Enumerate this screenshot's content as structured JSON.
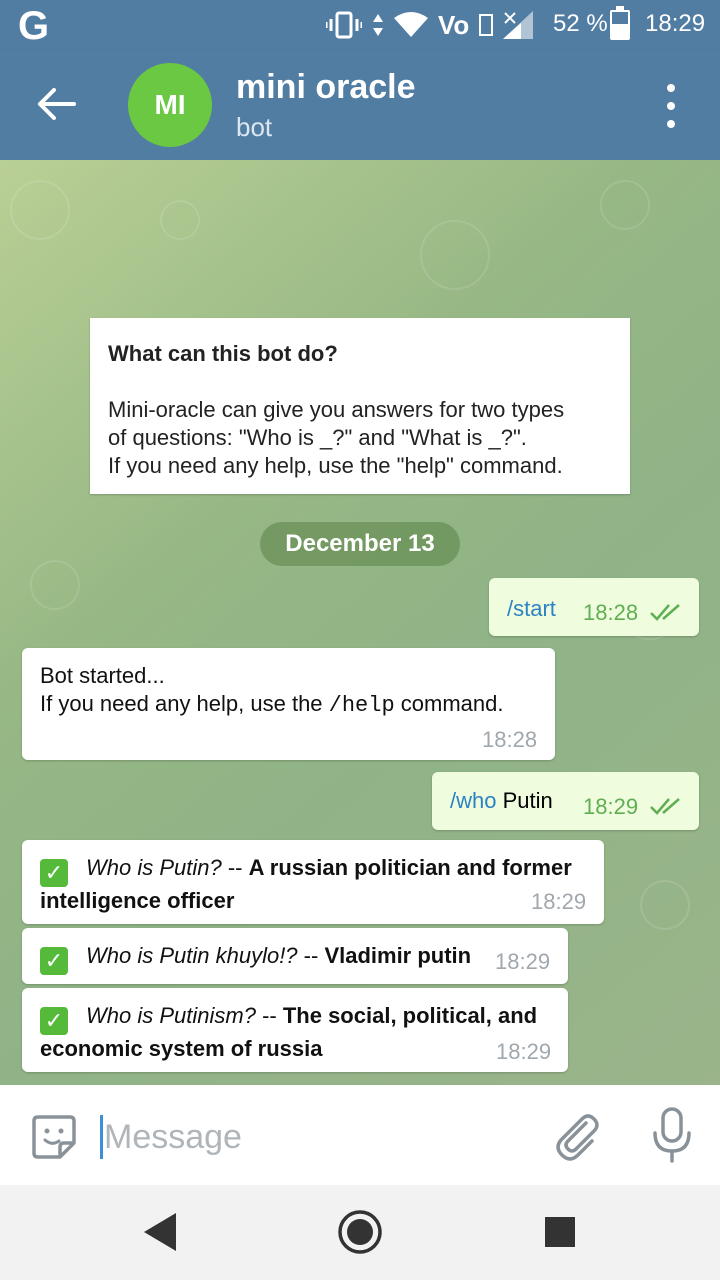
{
  "status_bar": {
    "carrier_icon": "G",
    "battery_percent": "52 %",
    "time": "18:29",
    "volte": "Vo"
  },
  "header": {
    "avatar_initials": "MI",
    "title": "mini oracle",
    "subtitle": "bot"
  },
  "intro_card": {
    "question": "What can this bot do?",
    "lines": [
      "Mini-oracle can give you answers for two types",
      "of questions: \"Who is _?\" and \"What is _?\".",
      "If you need any help, use the \"help\" command."
    ]
  },
  "date_separator": "December 13",
  "messages": {
    "m1": {
      "command": "/start",
      "time": "18:28"
    },
    "m2": {
      "line1": "Bot started...",
      "pre": "If you need any help, use the ",
      "code": "/help",
      "post": " command.",
      "time": "18:28"
    },
    "m3": {
      "command": "/who",
      "text": " Putin",
      "time": "18:29"
    },
    "m4": {
      "check": "✓",
      "question": "Who is Putin?",
      "sep": " -- ",
      "answer_line1": "A russian politician and former",
      "answer_line2": "intelligence officer",
      "time": "18:29"
    },
    "m5": {
      "check": "✓",
      "question": "Who is Putin khuylo!?",
      "sep": " -- ",
      "answer": "Vladimir putin",
      "time": "18:29"
    },
    "m6": {
      "check": "✓",
      "question": "Who is Putinism?",
      "sep": " -- ",
      "answer_line1": "The social, political, and",
      "answer_line2": "economic system of russia",
      "time": "18:29"
    }
  },
  "composer": {
    "placeholder": "Message"
  },
  "colors": {
    "header": "#527da3",
    "avatar": "#6bc842",
    "outgoing_bubble": "#effdde",
    "link": "#2d82c4",
    "read_check": "#5fae53"
  }
}
